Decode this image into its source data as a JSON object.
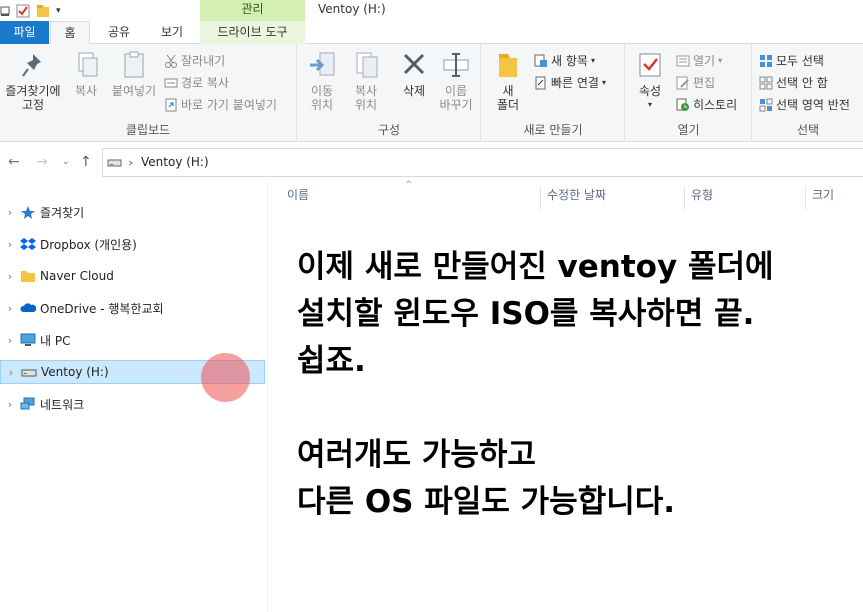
{
  "window": {
    "title": "Ventoy (H:)",
    "contextual_header": "관리"
  },
  "tabs": {
    "file": "파일",
    "home": "홈",
    "share": "공유",
    "view": "보기",
    "drive_tools": "드라이브 도구"
  },
  "ribbon": {
    "clipboard": {
      "label": "클립보드",
      "pin_line1": "즐겨찾기에",
      "pin_line2": "고정",
      "copy": "복사",
      "paste": "붙여넣기",
      "cut": "잘라내기",
      "copy_path": "경로 복사",
      "paste_shortcut": "바로 가기 붙여넣기"
    },
    "organize": {
      "label": "구성",
      "move_line1": "이동",
      "move_line2": "위치",
      "copyto_line1": "복사",
      "copyto_line2": "위치",
      "delete": "삭제",
      "rename_line1": "이름",
      "rename_line2": "바꾸기"
    },
    "new": {
      "label": "새로 만들기",
      "folder_line1": "새",
      "folder_line2": "폴더",
      "new_item": "새 항목",
      "easy_access": "빠른 연결"
    },
    "open": {
      "label": "열기",
      "properties": "속성",
      "open": "열기",
      "edit": "편집",
      "history": "히스토리"
    },
    "select": {
      "label": "선택",
      "select_all": "모두 선택",
      "select_none": "선택 안 함",
      "invert": "선택 영역 반전"
    }
  },
  "address": {
    "path": "Ventoy (H:)"
  },
  "nav_pane": {
    "items": [
      {
        "label": "즐겨찾기",
        "icon": "star-icon"
      },
      {
        "label": "Dropbox (개인용)",
        "icon": "dropbox-icon"
      },
      {
        "label": "Naver Cloud",
        "icon": "folder-icon"
      },
      {
        "label": "OneDrive - 행복한교회",
        "icon": "cloud-icon"
      },
      {
        "label": "내 PC",
        "icon": "computer-icon"
      },
      {
        "label": "Ventoy (H:)",
        "icon": "drive-icon",
        "selected": true
      },
      {
        "label": "네트워크",
        "icon": "network-icon"
      }
    ]
  },
  "columns": {
    "name": "이름",
    "modified": "수정한 날짜",
    "type": "유형",
    "size": "크기"
  },
  "overlay": {
    "line1": "이제 새로 만들어진 ventoy 폴더에",
    "line2": "설치할 윈도우 ISO를 복사하면 끝.",
    "line3": "쉽죠.",
    "line4": "",
    "line5": "여러개도 가능하고",
    "line6": "다른 OS 파일도 가능합니다."
  },
  "colors": {
    "file_tab": "#1979ca",
    "contextual": "#d3efb4",
    "selection": "#cce8ff",
    "cursor_marker": "#ee5050"
  }
}
